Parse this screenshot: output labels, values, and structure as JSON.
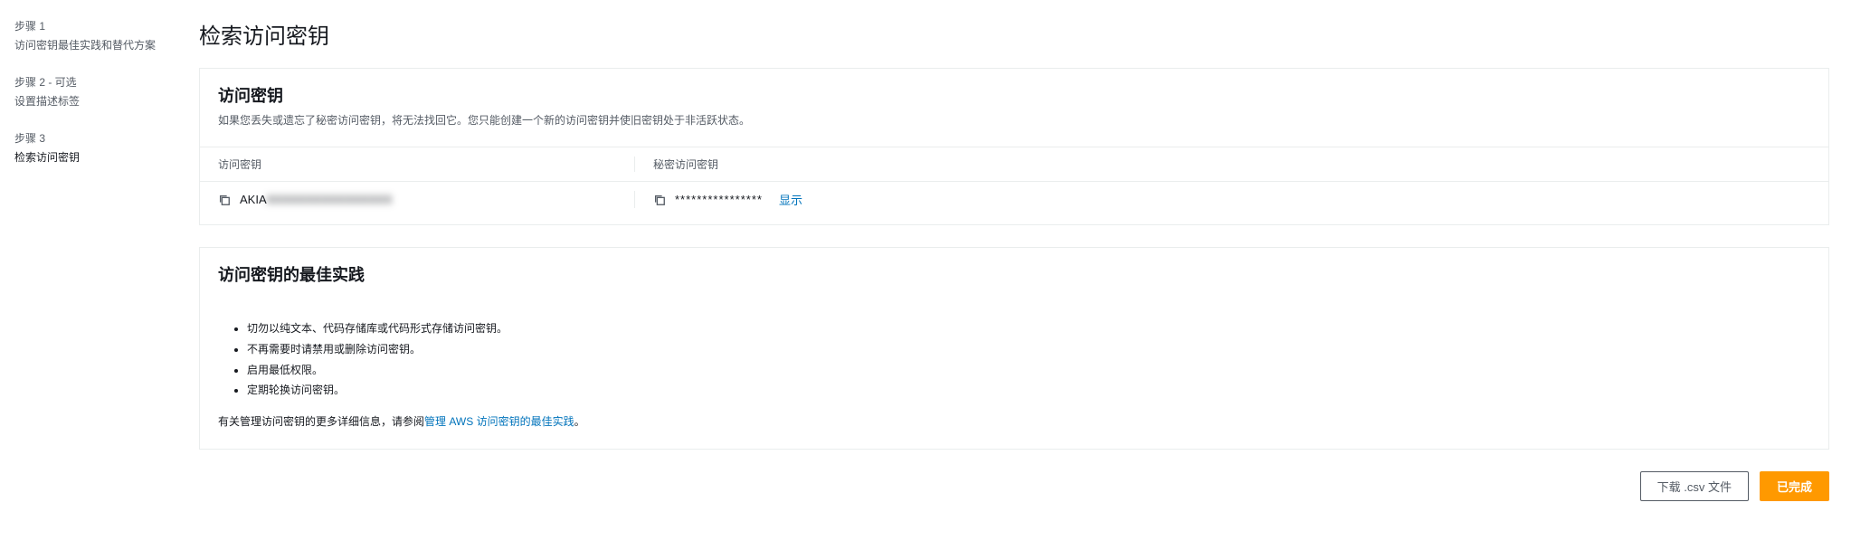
{
  "sidebar": {
    "steps": [
      {
        "label": "步骤 1",
        "title": "访问密钥最佳实践和替代方案"
      },
      {
        "label": "步骤 2 - 可选",
        "title": "设置描述标签"
      },
      {
        "label": "步骤 3",
        "title": "检索访问密钥"
      }
    ]
  },
  "page": {
    "title": "检索访问密钥"
  },
  "accessKeyPanel": {
    "title": "访问密钥",
    "description": "如果您丢失或遗忘了秘密访问密钥，将无法找回它。您只能创建一个新的访问密钥并使旧密钥处于非活跃状态。",
    "columns": {
      "accessKey": "访问密钥",
      "secretKey": "秘密访问密钥"
    },
    "row": {
      "accessKeyPrefix": "AKIA",
      "accessKeyHidden": "XXXXXXXXXXXXXXXX",
      "secretMasked": "****************",
      "showLabel": "显示"
    }
  },
  "bestPractices": {
    "title": "访问密钥的最佳实践",
    "items": [
      "切勿以纯文本、代码存储库或代码形式存储访问密钥。",
      "不再需要时请禁用或删除访问密钥。",
      "启用最低权限。",
      "定期轮换访问密钥。"
    ],
    "footerPrefix": "有关管理访问密钥的更多详细信息，请参阅",
    "footerLink": "管理 AWS 访问密钥的最佳实践",
    "footerSuffix": "。"
  },
  "actions": {
    "download": "下载 .csv 文件",
    "done": "已完成"
  }
}
